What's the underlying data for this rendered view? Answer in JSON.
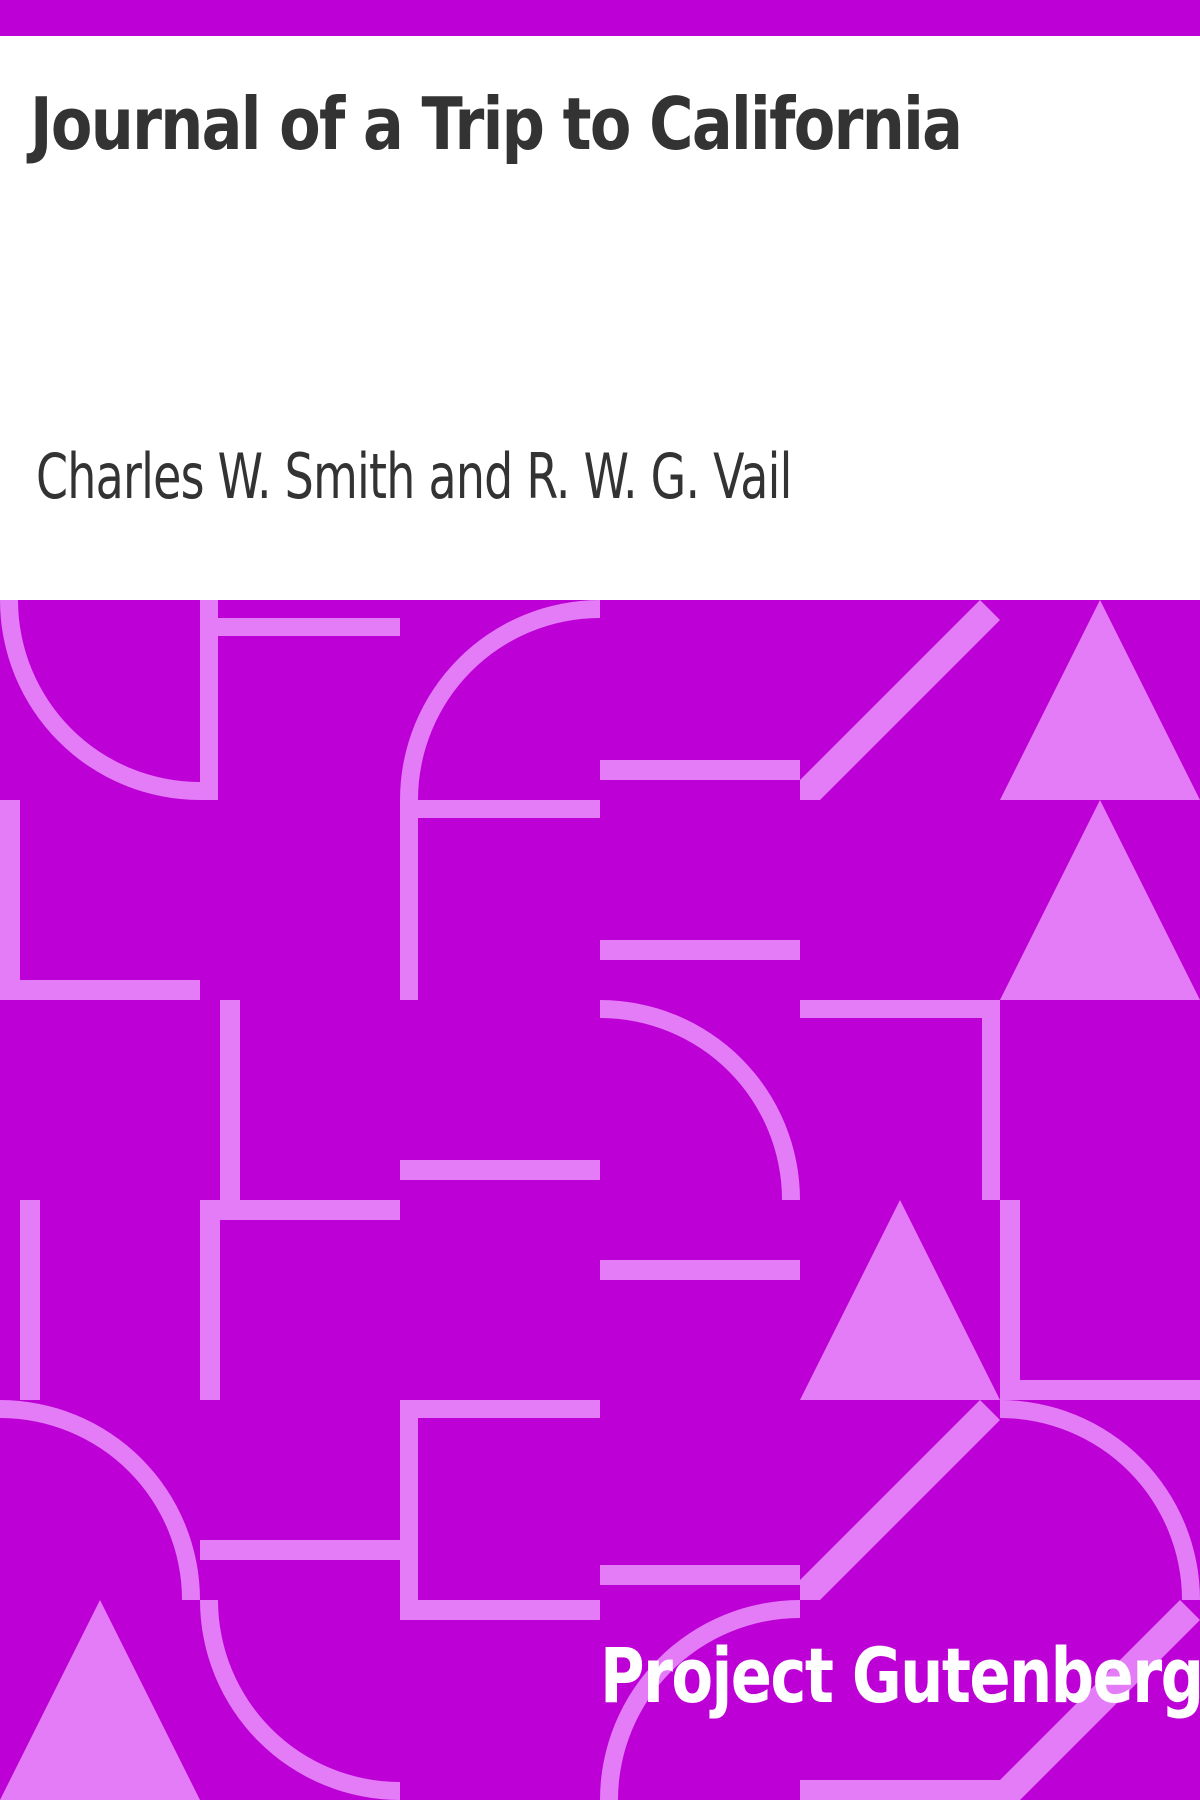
{
  "book": {
    "title": "Journal of a Trip to California",
    "author": "Charles W. Smith and R. W. G. Vail"
  },
  "publisher": {
    "name": "Project Gutenberg"
  },
  "colors": {
    "background": "#bd00d6",
    "pattern": "#e47cf8",
    "header_background": "#ffffff",
    "text": "#333333",
    "publisher_text": "#ffffff"
  }
}
